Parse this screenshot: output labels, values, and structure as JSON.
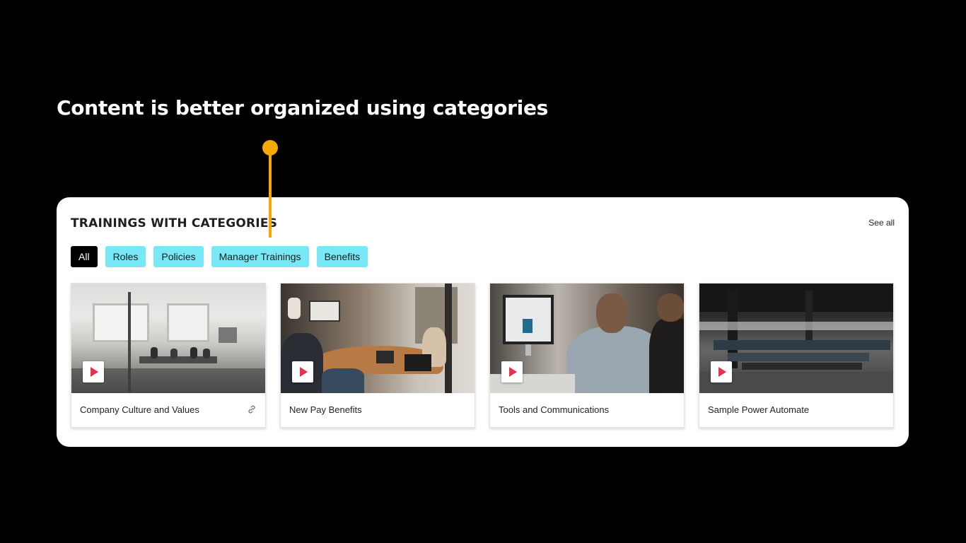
{
  "headline": "Content is better organized using categories",
  "panel": {
    "title": "TRAININGS WITH CATEGORIES",
    "see_all": "See all",
    "chips": [
      "All",
      "Roles",
      "Policies",
      "Manager Trainings",
      "Benefits"
    ],
    "active_chip": "All",
    "cards": [
      {
        "title": "Company Culture and Values",
        "has_link_icon": true
      },
      {
        "title": "New Pay Benefits",
        "has_link_icon": false
      },
      {
        "title": "Tools and Communications",
        "has_link_icon": false
      },
      {
        "title": "Sample Power Automate",
        "has_link_icon": false
      }
    ]
  },
  "icons": {
    "play": "play-icon",
    "link": "link-icon"
  },
  "colors": {
    "accent": "#f5a800",
    "chip": "#79e8f6",
    "chip_active": "#000000",
    "play": "#e8304f"
  }
}
